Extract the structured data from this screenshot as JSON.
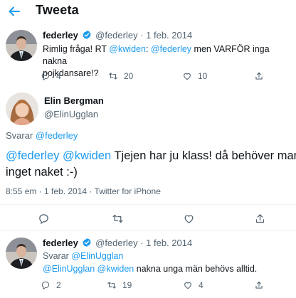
{
  "header": {
    "title": "Tweeta"
  },
  "tweet1": {
    "name": "federley",
    "handle": "@federley",
    "date": "· 1 feb. 2014",
    "text_prefix": "Rimlig fråga! RT ",
    "mention1": "@kwiden",
    "sep": ": ",
    "mention2": "@federley",
    "text_rest_line1": " men VARFÖR inga nakna",
    "text_line2": "pojkdansare!?",
    "replies": "4",
    "retweets": "20",
    "likes": "10"
  },
  "main": {
    "name": "Elin Bergman",
    "handle": "@ElinUgglan",
    "replying_to_label": "Svarar",
    "replying_to_handle": "@federley",
    "mention1": "@federley",
    "mention2": "@kwiden",
    "text_line1_rest": " Tjejen har ju klass! då behöver man",
    "text_line2": "inget naket :-)",
    "meta": "8:55 em · 1 feb. 2014 · Twitter for iPhone"
  },
  "tweet3": {
    "name": "federley",
    "handle": "@federley",
    "date": "· 1 feb. 2014",
    "replying_to_label": "Svarar",
    "replying_to_handle": "@ElinUgglan",
    "mention1": "@ElinUgglan",
    "mention2": "@kwiden",
    "text_rest": " nakna unga män behövs alltid.",
    "replies": "2",
    "retweets": "19",
    "likes": "4"
  },
  "colors": {
    "accent": "#1d9bf0",
    "verified": "#1d9bf0",
    "muted": "#536471"
  }
}
